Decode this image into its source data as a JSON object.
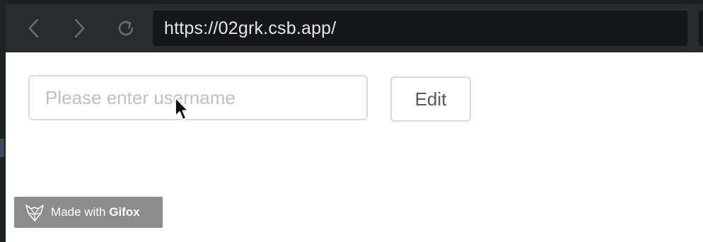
{
  "browser": {
    "url": "https://02grk.csb.app/",
    "back_icon": "chevron-left-icon",
    "forward_icon": "chevron-right-icon",
    "reload_icon": "reload-icon"
  },
  "form": {
    "username_placeholder": "Please enter username",
    "username_value": "",
    "edit_label": "Edit"
  },
  "watermark": {
    "prefix": "Made with",
    "brand": "Gifox",
    "icon": "fox-logo-icon"
  },
  "colors": {
    "toolbar": "#2a2b2e",
    "url_bar": "#16171a",
    "border": "#d9d9d9",
    "badge": "#8c8c8c"
  }
}
